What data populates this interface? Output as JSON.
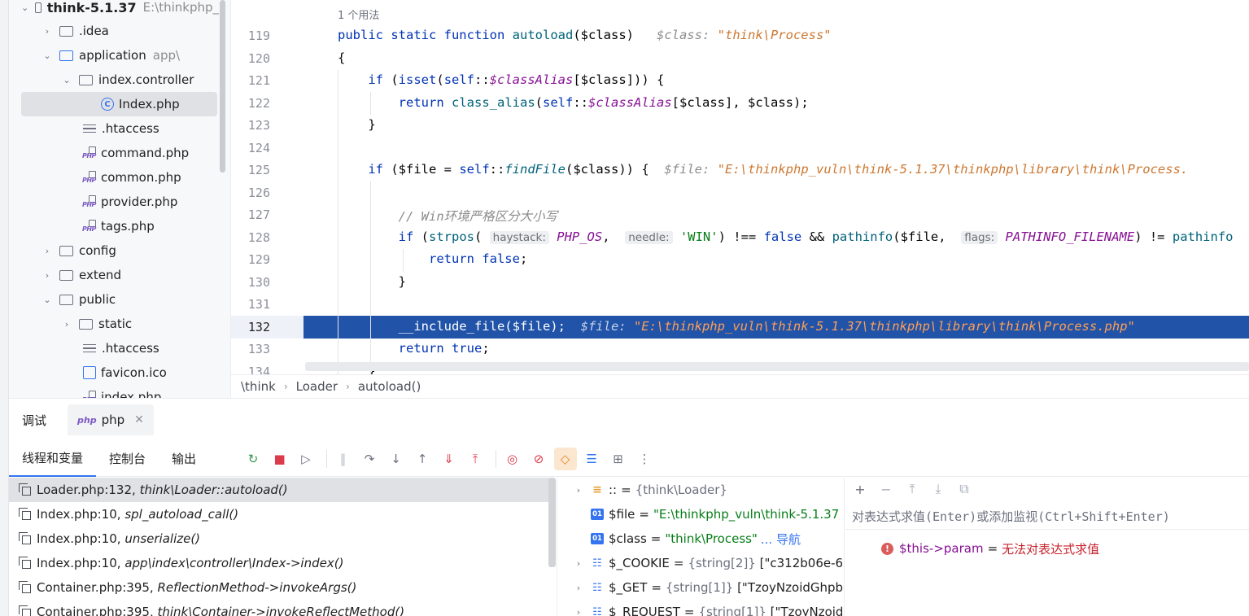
{
  "tree": {
    "items": [
      {
        "label": "think-5.1.37",
        "hint": "E:\\thinkphp_"
      },
      {
        "label": ".idea"
      },
      {
        "label": "application",
        "hint": "app\\"
      },
      {
        "label": "index.controller"
      },
      {
        "label": "Index.php"
      },
      {
        "label": ".htaccess"
      },
      {
        "label": "command.php"
      },
      {
        "label": "common.php"
      },
      {
        "label": "provider.php"
      },
      {
        "label": "tags.php"
      },
      {
        "label": "config"
      },
      {
        "label": "extend"
      },
      {
        "label": "public"
      },
      {
        "label": "static"
      },
      {
        "label": ".htaccess"
      },
      {
        "label": "favicon.ico"
      },
      {
        "label": "index.php"
      }
    ]
  },
  "editor": {
    "usage_hint": "1 个用法",
    "line_numbers": [
      "119",
      "120",
      "121",
      "122",
      "123",
      "124",
      "125",
      "126",
      "127",
      "128",
      "129",
      "130",
      "131",
      "132",
      "133",
      "134"
    ],
    "inlay": {
      "class_label": "$class:",
      "class_value": "\"think\\Process\"",
      "file_label": "$file:",
      "file_value_125": "\"E:\\thinkphp_vuln\\think-5.1.37\\thinkphp\\library\\think\\Process.",
      "file_value_132": "\"E:\\thinkphp_vuln\\think-5.1.37\\thinkphp\\library\\think\\Process.php\"",
      "param_haystack": "haystack:",
      "param_needle": "needle:",
      "param_flags": "flags:"
    },
    "comment_127": "// Win环境严格区分大小写",
    "current_line": "132"
  },
  "breadcrumb": [
    "\\think",
    "Loader",
    "autoload()"
  ],
  "debug": {
    "title": "调试",
    "tab_label": "php",
    "subtabs": [
      "线程和变量",
      "控制台",
      "输出"
    ],
    "frames": [
      {
        "loc": "Loader.php:132,",
        "fn": "think\\Loader::autoload()"
      },
      {
        "loc": "Index.php:10,",
        "fn": "spl_autoload_call()"
      },
      {
        "loc": "Index.php:10,",
        "fn": "unserialize()"
      },
      {
        "loc": "Index.php:10,",
        "fn": "app\\index\\controller\\Index->index()"
      },
      {
        "loc": "Container.php:395,",
        "fn": "ReflectionMethod->invokeArgs()"
      },
      {
        "loc": "Container.php:395,",
        "fn": "think\\Container->invokeReflectMethod()"
      }
    ],
    "variables": [
      {
        "name": "::",
        "type": "{think\\Loader}",
        "value": ""
      },
      {
        "name": "$file",
        "type": "",
        "value": "\"E:\\thinkphp_vuln\\think-5.1.37"
      },
      {
        "name": "$class",
        "type": "",
        "value": "\"think\\Process\"",
        "link": "... 导航"
      },
      {
        "name": "$_COOKIE",
        "type": "{string[2]}",
        "value": "[\"c312b06e-6"
      },
      {
        "name": "$_GET",
        "type": "{string[1]}",
        "value": "[\"TzoyNzoidGhpbl"
      },
      {
        "name": "$_REQUEST",
        "type": "{string[1]}",
        "value": "[\"TzoyNzoid"
      }
    ],
    "watch": {
      "placeholder": "对表达式求值(Enter)或添加监视(Ctrl+Shift+Enter)",
      "entry_name": "$this->param",
      "entry_error": "无法对表达式求值"
    }
  }
}
